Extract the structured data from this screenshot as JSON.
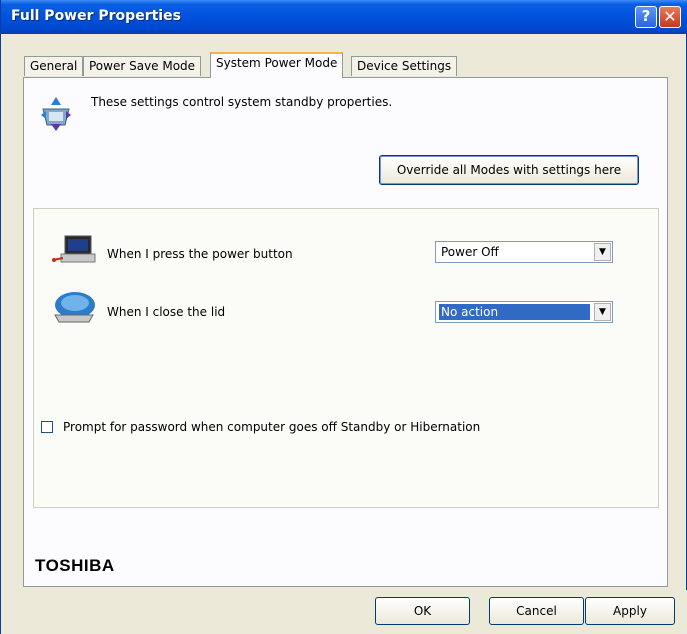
{
  "window": {
    "title": "Full Power Properties",
    "help_glyph": "?",
    "close_glyph": "✕"
  },
  "tabs": [
    {
      "label": "General"
    },
    {
      "label": "Power Save Mode"
    },
    {
      "label": "System Power Mode",
      "active": true
    },
    {
      "label": "Device Settings"
    }
  ],
  "intro_text": "These settings control system standby properties.",
  "override_button": "Override all Modes with settings here",
  "power_button": {
    "label": "When I press the power button",
    "value": "Power Off"
  },
  "lid": {
    "label": "When I close the lid",
    "value": "No action"
  },
  "password_prompt": {
    "label": "Prompt for password when computer goes off Standby or Hibernation",
    "checked": false
  },
  "brand": "TOSHIBA",
  "buttons": {
    "ok": "OK",
    "cancel": "Cancel",
    "apply": "Apply"
  },
  "dropdown_arrow": "▼",
  "colors": {
    "titlebar": "#0052dd",
    "selection": "#316ac5",
    "dialog_bg": "#ece9d8"
  }
}
